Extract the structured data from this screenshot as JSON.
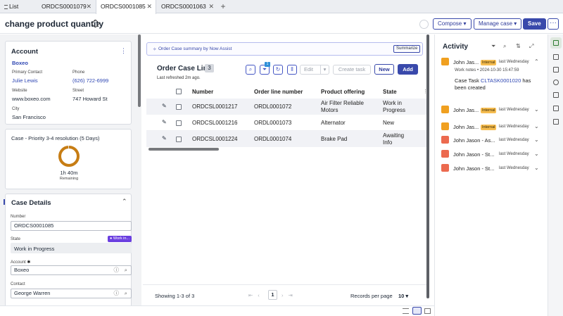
{
  "tabs": [
    {
      "label": "List"
    },
    {
      "label": "ORDCS0001079"
    },
    {
      "label": "ORDCS0001085"
    },
    {
      "label": "ORDCS0001063"
    }
  ],
  "header": {
    "title": "change product quantity",
    "compose": "Compose",
    "manage": "Manage case",
    "save": "Save",
    "more": "···"
  },
  "account": {
    "heading": "Account",
    "name": "Boxeo",
    "primary_contact_label": "Primary Contact",
    "primary_contact": "Julie Lewis",
    "phone_label": "Phone",
    "phone": "(626) 722-6999",
    "website_label": "Website",
    "website": "www.boxeo.com",
    "street_label": "Street",
    "street": "747 Howard St",
    "city_label": "City",
    "city": "San Francisco"
  },
  "sla": {
    "title": "Case - Priority 3-4 resolution (5 Days)",
    "time": "1h 40m",
    "remaining": "Remaining",
    "elapsed_fraction": 0.98
  },
  "case_details": {
    "heading": "Case Details",
    "number_label": "Number",
    "number": "ORDCS0001085",
    "state_label": "State",
    "state_badge": "Work in...",
    "state": "Work in Progress",
    "account_label": "Account",
    "account": "Boxeo",
    "contact_label": "Contact",
    "contact": "George Warren"
  },
  "assist": {
    "text": "Order Case summary by Now Assist",
    "button": "Summarize"
  },
  "order_lines": {
    "title": "Order Case Line",
    "count": "3",
    "refreshed": "Last refreshed 2m ago.",
    "filter_count": "1",
    "edit": "Edit",
    "create_task": "Create task",
    "new": "New",
    "add": "Add",
    "columns": [
      "Number",
      "Order line number",
      "Product offering",
      "State"
    ],
    "rows": [
      {
        "number": "ORDCSL0001217",
        "line": "ORDL0001072",
        "product": "Air Filter Reliable Motors",
        "state": "Work in Progress"
      },
      {
        "number": "ORDCSL0001216",
        "line": "ORDL0001073",
        "product": "Alternator",
        "state": "New"
      },
      {
        "number": "ORDCSL0001224",
        "line": "ORDL0001074",
        "product": "Brake Pad",
        "state": "Awaiting Info"
      }
    ],
    "showing": "Showing 1-3 of 3",
    "page": "1",
    "records_label": "Records per page",
    "records_value": "10"
  },
  "activity": {
    "heading": "Activity",
    "items": [
      {
        "name": "John Jas...",
        "badge": "Internal",
        "time": "last Wednesday",
        "expanded": true,
        "color": "#f0a020"
      },
      {
        "name": "John Jas...",
        "badge": "Internal",
        "time": "last Wednesday",
        "expanded": false,
        "color": "#f0a020"
      },
      {
        "name": "John Jas...",
        "badge": "Internal",
        "time": "last Wednesday",
        "expanded": false,
        "color": "#f0a020"
      },
      {
        "name": "John Jason - As...",
        "badge": "",
        "time": "last Wednesday",
        "expanded": false,
        "color": "#ec6a4f"
      },
      {
        "name": "John Jason - St...",
        "badge": "",
        "time": "last Wednesday",
        "expanded": false,
        "color": "#ec6a4f"
      },
      {
        "name": "John Jason - St...",
        "badge": "",
        "time": "last Wednesday",
        "expanded": false,
        "color": "#ec6a4f"
      }
    ],
    "work_notes_label": "Work notes",
    "work_notes_time": "• 2024-10-30 15:47:59",
    "note_prefix": "Case Task",
    "note_link": "CLTASK0001020",
    "note_suffix": "has been",
    "note_suffix2": "created"
  },
  "colors": {
    "accent": "#3949ab",
    "link": "#2f47b3",
    "internal_badge": "#f6bd51",
    "sla_ring": "#c77d14"
  }
}
